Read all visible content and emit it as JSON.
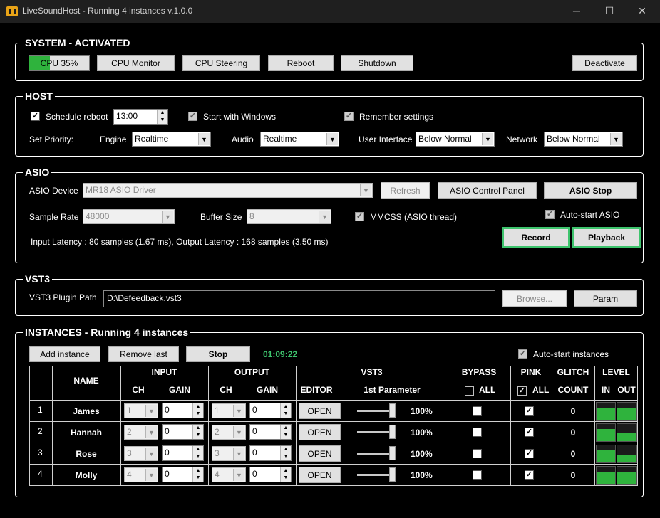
{
  "window": {
    "title": "LiveSoundHost - Running 4 instances v.1.0.0",
    "minimize": "─",
    "maximize": "☐",
    "close": "✕"
  },
  "system": {
    "label": "SYSTEM - ACTIVATED",
    "cpu_label": "CPU 35%",
    "cpu_percent": 35,
    "cpu_monitor": "CPU Monitor",
    "cpu_steering": "CPU Steering",
    "reboot": "Reboot",
    "shutdown": "Shutdown",
    "deactivate": "Deactivate"
  },
  "host": {
    "label": "HOST",
    "schedule_reboot": "Schedule reboot",
    "schedule_reboot_checked": true,
    "reboot_time": "13:00",
    "start_with_windows": "Start with Windows",
    "remember_settings": "Remember settings",
    "set_priority": "Set Priority:",
    "engine_label": "Engine",
    "engine_value": "Realtime",
    "audio_label": "Audio",
    "audio_value": "Realtime",
    "ui_label": "User Interface",
    "ui_value": "Below Normal",
    "network_label": "Network",
    "network_value": "Below Normal"
  },
  "asio": {
    "label": "ASIO",
    "device_label": "ASIO Device",
    "device_value": "MR18 ASIO Driver",
    "refresh": "Refresh",
    "control_panel": "ASIO Control Panel",
    "stop": "ASIO Stop",
    "sample_rate_label": "Sample Rate",
    "sample_rate_value": "48000",
    "buffer_size_label": "Buffer Size",
    "buffer_size_value": "8",
    "mmcss": "MMCSS (ASIO thread)",
    "auto_start": "Auto-start ASIO",
    "latency": "Input Latency : 80 samples (1.67 ms), Output Latency : 168 samples (3.50 ms)",
    "record": "Record",
    "playback": "Playback"
  },
  "vst3": {
    "label": "VST3",
    "path_label": "VST3 Plugin Path",
    "path_value": "D:\\Defeedback.vst3",
    "browse": "Browse...",
    "param": "Param"
  },
  "instances": {
    "label": "INSTANCES - Running 4 instances",
    "add": "Add instance",
    "remove": "Remove last",
    "stop": "Stop",
    "timer": "01:09:22",
    "auto_start": "Auto-start instances",
    "headers": {
      "name": "NAME",
      "input": "INPUT",
      "output": "OUTPUT",
      "vst3": "VST3",
      "bypass": "BYPASS",
      "pink": "PINK",
      "glitch": "GLITCH",
      "level": "LEVEL",
      "ch": "CH",
      "gain": "GAIN",
      "editor": "EDITOR",
      "first_param": "1st Parameter",
      "all": "ALL",
      "count": "COUNT",
      "in": "IN",
      "out": "OUT"
    },
    "open_label": "OPEN",
    "rows": [
      {
        "num": "1",
        "name": "James",
        "in_ch": "1",
        "in_gain": "0",
        "out_ch": "1",
        "out_gain": "0",
        "param": "100%",
        "bypass": false,
        "pink": true,
        "glitch": "0",
        "level_in": 0.72,
        "level_out": 0.72
      },
      {
        "num": "2",
        "name": "Hannah",
        "in_ch": "2",
        "in_gain": "0",
        "out_ch": "2",
        "out_gain": "0",
        "param": "100%",
        "bypass": false,
        "pink": true,
        "glitch": "0",
        "level_in": 0.72,
        "level_out": 0.46
      },
      {
        "num": "3",
        "name": "Rose",
        "in_ch": "3",
        "in_gain": "0",
        "out_ch": "3",
        "out_gain": "0",
        "param": "100%",
        "bypass": false,
        "pink": true,
        "glitch": "0",
        "level_in": 0.72,
        "level_out": 0.46
      },
      {
        "num": "4",
        "name": "Molly",
        "in_ch": "4",
        "in_gain": "0",
        "out_ch": "4",
        "out_gain": "0",
        "param": "100%",
        "bypass": false,
        "pink": true,
        "glitch": "0",
        "level_in": 0.72,
        "level_out": 0.72
      }
    ]
  },
  "colors": {
    "accent_green": "#2fb33d",
    "timer_green": "#3ec46d",
    "background": "#000000"
  }
}
